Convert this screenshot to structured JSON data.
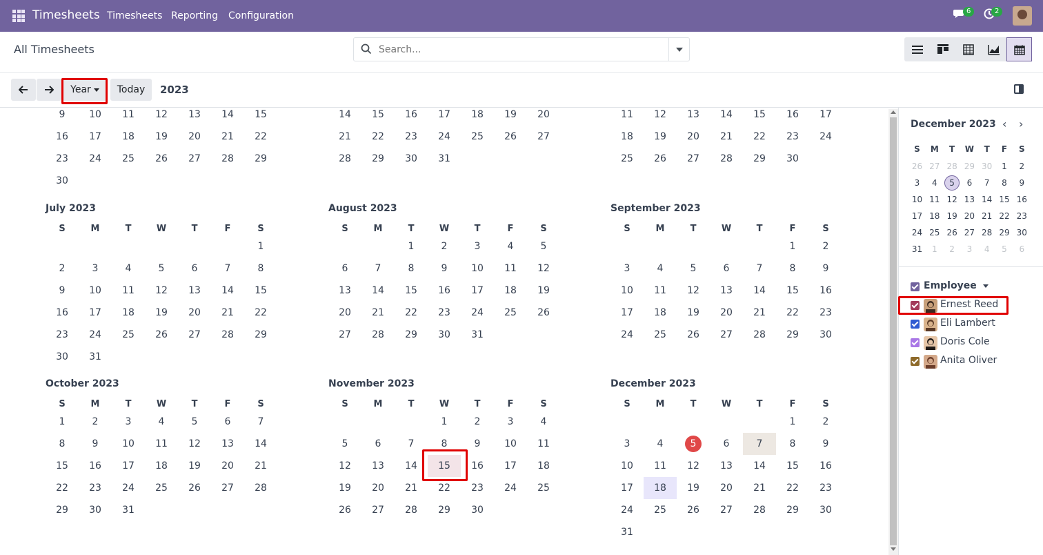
{
  "topbar": {
    "app_title": "Timesheets",
    "menu": [
      "Timesheets",
      "Reporting",
      "Configuration"
    ],
    "messages_count": "6",
    "activities_count": "2"
  },
  "control": {
    "title": "All Timesheets",
    "search_placeholder": "Search...",
    "views": [
      "list-icon",
      "kanban-icon",
      "pivot-icon",
      "graph-icon",
      "calendar-icon"
    ]
  },
  "toolbar": {
    "scale_label": "Year",
    "today_label": "Today",
    "period_label": "2023"
  },
  "dow": [
    "S",
    "M",
    "T",
    "W",
    "T",
    "F",
    "S"
  ],
  "top_partial_rows": [
    [
      [
        "9",
        "10",
        "11",
        "12",
        "13",
        "14",
        "15"
      ],
      [
        "16",
        "17",
        "18",
        "19",
        "20",
        "21",
        "22"
      ],
      [
        "23",
        "24",
        "25",
        "26",
        "27",
        "28",
        "29"
      ],
      [
        "30",
        "",
        "",
        "",
        "",
        "",
        ""
      ]
    ],
    [
      [
        "14",
        "15",
        "16",
        "17",
        "18",
        "19",
        "20"
      ],
      [
        "21",
        "22",
        "23",
        "24",
        "25",
        "26",
        "27"
      ],
      [
        "28",
        "29",
        "30",
        "31",
        "",
        "",
        ""
      ]
    ],
    [
      [
        "11",
        "12",
        "13",
        "14",
        "15",
        "16",
        "17"
      ],
      [
        "18",
        "19",
        "20",
        "21",
        "22",
        "23",
        "24"
      ],
      [
        "25",
        "26",
        "27",
        "28",
        "29",
        "30",
        ""
      ]
    ]
  ],
  "months": [
    {
      "title": "July 2023",
      "start": 6,
      "days": 31
    },
    {
      "title": "August 2023",
      "start": 2,
      "days": 31
    },
    {
      "title": "September 2023",
      "start": 5,
      "days": 30
    },
    {
      "title": "October 2023",
      "start": 0,
      "days": 31
    },
    {
      "title": "November 2023",
      "start": 3,
      "days": 30
    },
    {
      "title": "December 2023",
      "start": 5,
      "days": 31
    }
  ],
  "mini_calendar": {
    "title": "December 2023",
    "rows": [
      [
        "26",
        "27",
        "28",
        "29",
        "30",
        "1",
        "2"
      ],
      [
        "3",
        "4",
        "5",
        "6",
        "7",
        "8",
        "9"
      ],
      [
        "10",
        "11",
        "12",
        "13",
        "14",
        "15",
        "16"
      ],
      [
        "17",
        "18",
        "19",
        "20",
        "21",
        "22",
        "23"
      ],
      [
        "24",
        "25",
        "26",
        "27",
        "28",
        "29",
        "30"
      ],
      [
        "31",
        "1",
        "2",
        "3",
        "4",
        "5",
        "6"
      ]
    ]
  },
  "filters": {
    "heading": "Employee",
    "employees": [
      {
        "name": "Ernest Reed",
        "color": "#a33b5a"
      },
      {
        "name": "Eli Lambert",
        "color": "#2f5bd1"
      },
      {
        "name": "Doris Cole",
        "color": "#a977e6"
      },
      {
        "name": "Anita Oliver",
        "color": "#8e6a2a"
      }
    ]
  },
  "colors": {
    "brand": "#71639e",
    "today": "#e04848"
  }
}
